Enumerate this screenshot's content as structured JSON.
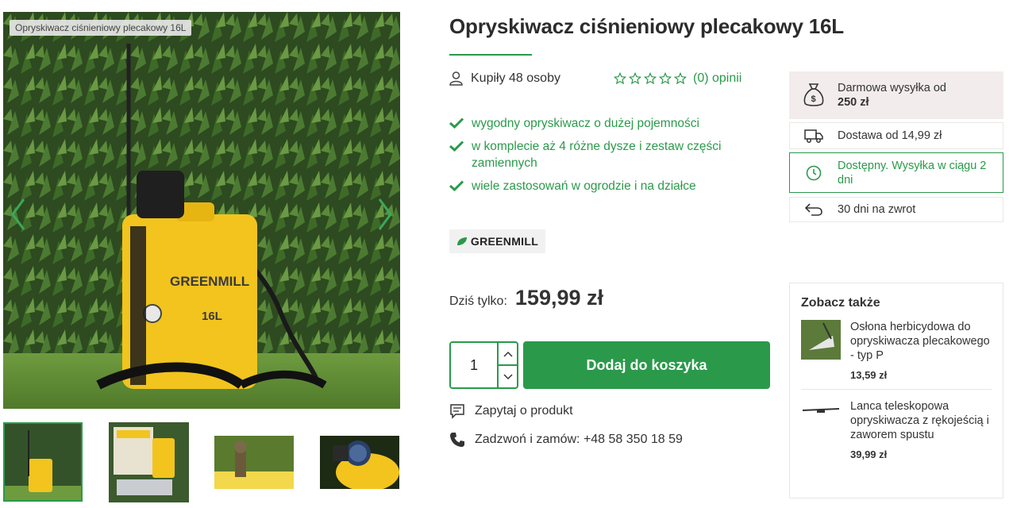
{
  "gallery": {
    "caption": "Opryskiwacz ciśnieniowy plecakowy 16L",
    "product_label_brand": "GREENMILL",
    "product_label_size": "16L",
    "thumbnails": [
      "thumb-1",
      "thumb-2",
      "thumb-3",
      "thumb-4"
    ],
    "active_thumbnail": 0
  },
  "product": {
    "title": "Opryskiwacz ciśnieniowy plecakowy 16L",
    "buyers": "Kupiły 48 osoby",
    "rating_count": "(0) opinii",
    "rating_value": 0,
    "features": [
      "wygodny opryskiwacz o dużej pojemności",
      "w komplecie aż 4 różne dysze i zestaw części zamiennych",
      "wiele zastosowań w ogrodzie i na działce"
    ],
    "brand": "GREENMILL",
    "price_label": "Dziś tylko:",
    "price": "159,99 zł",
    "quantity": "1",
    "add_to_cart": "Dodaj do koszyka",
    "ask_product": "Zapytaj o produkt",
    "call_order": "Zadzwoń i zamów: +48 58 350 18 59"
  },
  "shipping": {
    "free_line1": "Darmowa wysyłka od",
    "free_line2": "250 zł",
    "delivery": "Dostawa od 14,99 zł",
    "availability": "Dostępny. Wysyłka w ciągu 2 dni",
    "returns": "30 dni na zwrot"
  },
  "see_also": {
    "heading": "Zobacz także",
    "items": [
      {
        "name": "Osłona herbicydowa do opryskiwacza plecakowego - typ P",
        "price": "13,59 zł"
      },
      {
        "name": "Lanca teleskopowa opryskiwacza z rękojeścią i zaworem spustu",
        "price": "39,99 zł"
      }
    ]
  },
  "colors": {
    "accent": "#2a9a4a",
    "free_shipping_bg": "#f3ecec",
    "product_yellow": "#f2c41d"
  }
}
